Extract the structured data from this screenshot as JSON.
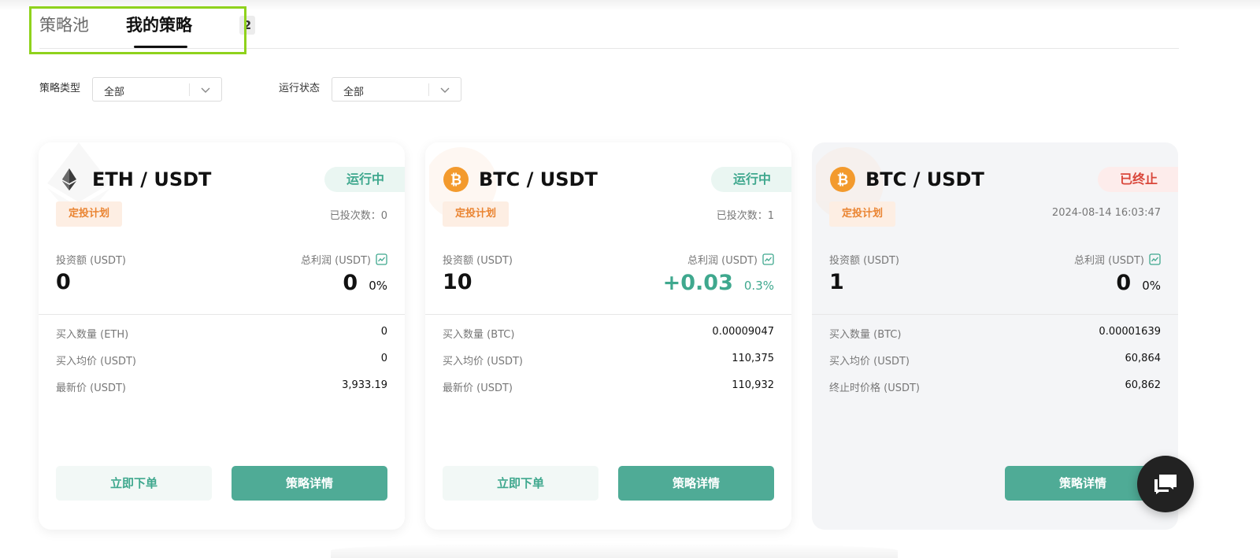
{
  "tabs": {
    "pool": "策略池",
    "mine": "我的策略",
    "mine_count": "2"
  },
  "filters": [
    {
      "label": "策略类型",
      "value": "全部"
    },
    {
      "label": "运行状态",
      "value": "全部"
    }
  ],
  "cards": [
    {
      "coin": "eth",
      "pair": "ETH / USDT",
      "status": "运行中",
      "type_tag": "定投计划",
      "meta_right": "已投次数：0",
      "investment_label": "投资额 (USDT)",
      "investment_value": "0",
      "profit_label": "总利润 (USDT)",
      "profit_value": "0",
      "profit_pct": "0%",
      "rows": [
        {
          "label": "买入数量 (ETH)",
          "value": "0"
        },
        {
          "label": "买入均价 (USDT)",
          "value": "0"
        },
        {
          "label": "最新价 (USDT)",
          "value": "3,933.19"
        }
      ],
      "btn_order": "立即下单",
      "btn_detail": "策略详情"
    },
    {
      "coin": "btc",
      "pair": "BTC / USDT",
      "status": "运行中",
      "type_tag": "定投计划",
      "meta_right": "已投次数：1",
      "investment_label": "投资额 (USDT)",
      "investment_value": "10",
      "profit_label": "总利润 (USDT)",
      "profit_value": "+0.03",
      "profit_pct": "0.3%",
      "rows": [
        {
          "label": "买入数量 (BTC)",
          "value": "0.00009047"
        },
        {
          "label": "买入均价 (USDT)",
          "value": "110,375"
        },
        {
          "label": "最新价 (USDT)",
          "value": "110,932"
        }
      ],
      "btn_order": "立即下单",
      "btn_detail": "策略详情"
    },
    {
      "coin": "btc",
      "pair": "BTC / USDT",
      "status": "已终止",
      "type_tag": "定投计划",
      "meta_right": "2024-08-14 16:03:47",
      "investment_label": "投资额 (USDT)",
      "investment_value": "1",
      "profit_label": "总利润 (USDT)",
      "profit_value": "0",
      "profit_pct": "0%",
      "rows": [
        {
          "label": "买入数量 (BTC)",
          "value": "0.00001639"
        },
        {
          "label": "买入均价 (USDT)",
          "value": "60,864"
        },
        {
          "label": "终止时价格 (USDT)",
          "value": "60,862"
        }
      ],
      "btn_detail": "策略详情"
    }
  ],
  "colors": {
    "accent": "#4fab96",
    "running": "#3fa88e",
    "stopped": "#d9463a",
    "tag": "#ea8431",
    "highlight": "#8fd21c"
  },
  "icons": {
    "eth": "ethereum-icon",
    "btc": "bitcoin-icon",
    "chart": "trend-chart-icon",
    "chat": "chat-icon",
    "chevron": "chevron-down-icon"
  }
}
